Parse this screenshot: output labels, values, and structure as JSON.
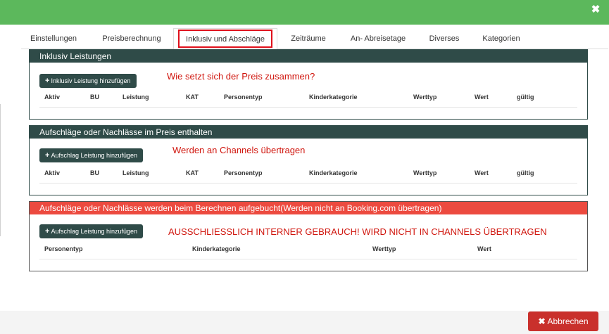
{
  "window": {
    "close_icon": "close-icon",
    "close_glyph": "✖"
  },
  "tabs": [
    {
      "label": "Einstellungen"
    },
    {
      "label": "Preisberechnung"
    },
    {
      "label": "Inklusiv und Abschläge",
      "active": true
    },
    {
      "label": "Zeiträume"
    },
    {
      "label": "An- Abreisetage"
    },
    {
      "label": "Diverses"
    },
    {
      "label": "Kategorien"
    }
  ],
  "sections": {
    "inklusiv": {
      "title": "Inklusiv Leistungen",
      "button": "Inklusiv Leistung hinzufügen",
      "note": "Wie setzt sich der Preis zusammen?",
      "columns": [
        "Aktiv",
        "BU",
        "Leistung",
        "KAT",
        "Personentyp",
        "Kinderkategorie",
        "Werttyp",
        "Wert",
        "gültig"
      ]
    },
    "aufschlaege_enthalten": {
      "title": "Aufschläge oder Nachlässe im Preis enthalten",
      "button": "Aufschlag Leistung hinzufügen",
      "note": "Werden an Channels übertragen",
      "columns": [
        "Aktiv",
        "BU",
        "Leistung",
        "KAT",
        "Personentyp",
        "Kinderkategorie",
        "Werttyp",
        "Wert",
        "gültig"
      ]
    },
    "aufschlaege_aufgebucht": {
      "title": "Aufschläge oder Nachlässe werden beim Berechnen aufgebucht(Werden nicht an Booking.com übertragen)",
      "button": "Aufschlag Leistung hinzufügen",
      "note": "AUSSCHLIESSLICH INTERNER GEBRAUCH! WIRD NICHT IN CHANNELS ÜBERTRAGEN",
      "columns": [
        "Personentyp",
        "Kinderkategorie",
        "Werttyp",
        "Wert"
      ]
    }
  },
  "footer": {
    "cancel_label": "Abbrechen",
    "cancel_icon": "close-icon",
    "cancel_glyph": "✖"
  },
  "colors": {
    "topbar": "#5cb85c",
    "panel_header": "#2f4b48",
    "panel_header_warning": "#ec4a3f",
    "note_text": "#d0160e",
    "cancel_button": "#c9302c",
    "active_tab_highlight": "#e0101b"
  }
}
